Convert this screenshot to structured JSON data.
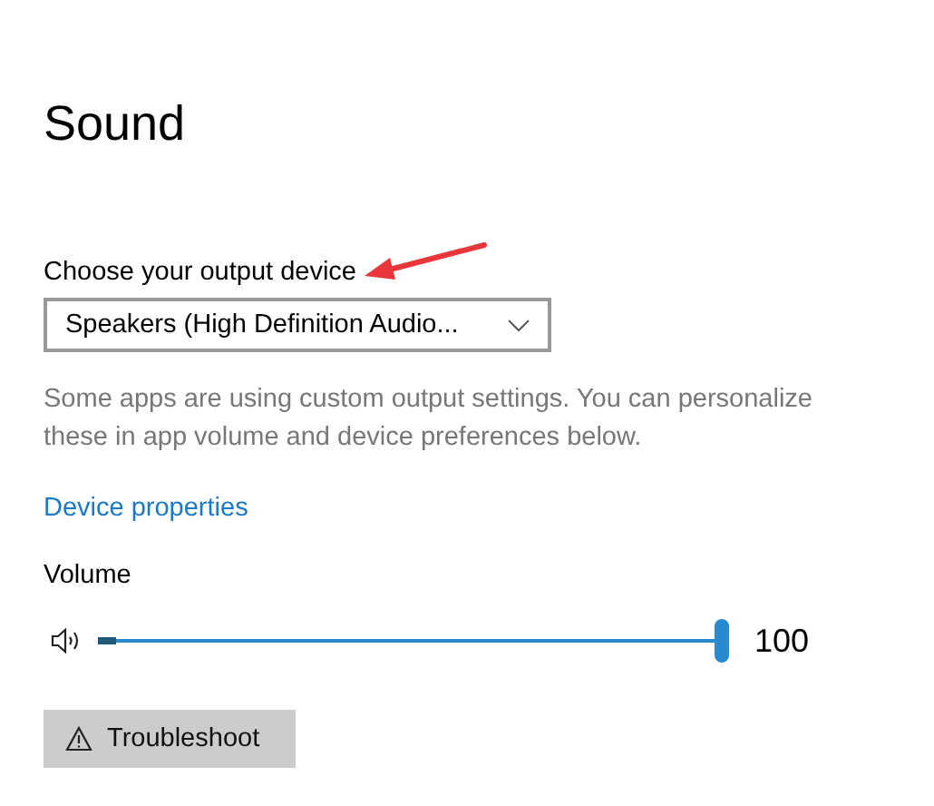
{
  "title": "Sound",
  "output": {
    "label": "Choose your output device",
    "value": "Speakers (High Definition Audio...",
    "description": "Some apps are using custom output settings. You can personalize these in app volume and device preferences below.",
    "link": "Device properties"
  },
  "volume": {
    "label": "Volume",
    "level": 1.0,
    "reading": "100"
  },
  "buttons": [
    {
      "label": "Troubleshoot"
    }
  ]
}
